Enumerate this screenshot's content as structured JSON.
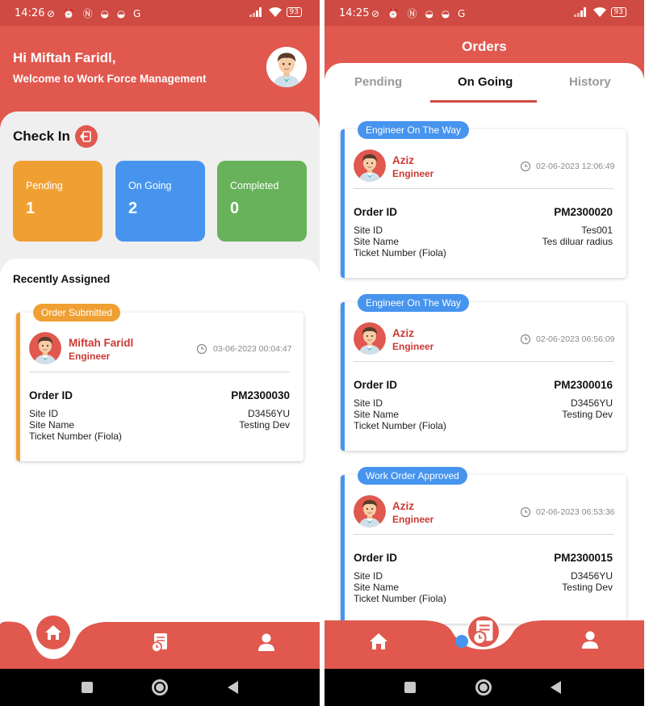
{
  "status_bar": {
    "left_time": "14:26",
    "right_time": "14:25",
    "notification_icons": [
      "no-call-icon",
      "alarm-icon",
      "nfc-icon",
      "game-icon",
      "game-icon",
      "google-icon"
    ],
    "battery": "93"
  },
  "home": {
    "greeting": "Hi Miftah Faridl,",
    "welcome": "Welcome to Work Force Management",
    "check_in_label": "Check In",
    "stats": [
      {
        "label": "Pending",
        "value": "1",
        "color": "#f0a033"
      },
      {
        "label": "On Going",
        "value": "2",
        "color": "#4794ee"
      },
      {
        "label": "Completed",
        "value": "0",
        "color": "#67b25a"
      }
    ],
    "recent_title": "Recently Assigned",
    "recent_card": {
      "badge": "Order Submitted",
      "badge_color": "#f0a033",
      "name": "Miftah Faridl",
      "role": "Engineer",
      "datetime": "03-06-2023 00:04:47",
      "order_id_label": "Order ID",
      "order_id": "PM2300030",
      "site_id_label": "Site ID",
      "site_id": "D3456YU",
      "site_name_label": "Site Name",
      "site_name": "Testing Dev",
      "ticket_label": "Ticket Number (Fiola)",
      "ticket": ""
    }
  },
  "orders": {
    "title": "Orders",
    "tabs": [
      "Pending",
      "On Going",
      "History"
    ],
    "active_tab": "On Going",
    "accent_color": "#4794ee",
    "cards": [
      {
        "badge": "Engineer On The Way",
        "name": "Aziz",
        "role": "Engineer",
        "datetime": "02-06-2023 12:06:49",
        "order_id_label": "Order ID",
        "order_id": "PM2300020",
        "site_id_label": "Site ID",
        "site_id": "Tes001",
        "site_name_label": "Site Name",
        "site_name": "Tes diluar radius",
        "ticket_label": "Ticket Number (Fiola)",
        "ticket": ""
      },
      {
        "badge": "Engineer On The Way",
        "name": "Aziz",
        "role": "Engineer",
        "datetime": "02-06-2023 06:56:09",
        "order_id_label": "Order ID",
        "order_id": "PM2300016",
        "site_id_label": "Site ID",
        "site_id": "D3456YU",
        "site_name_label": "Site Name",
        "site_name": "Testing Dev",
        "ticket_label": "Ticket Number (Fiola)",
        "ticket": ""
      },
      {
        "badge": "Work Order Approved",
        "name": "Aziz",
        "role": "Engineer",
        "datetime": "02-06-2023 06:53:36",
        "order_id_label": "Order ID",
        "order_id": "PM2300015",
        "site_id_label": "Site ID",
        "site_id": "D3456YU",
        "site_name_label": "Site Name",
        "site_name": "Testing Dev",
        "ticket_label": "Ticket Number (Fiola)",
        "ticket": ""
      }
    ]
  },
  "bottom_nav": {
    "left_active": "home",
    "right_active": "orders",
    "items": [
      "home-icon",
      "orders-icon",
      "profile-icon"
    ]
  },
  "theme": {
    "primary": "#e0584e",
    "dark_primary": "#cf4a42",
    "name_color": "#cc3a33"
  }
}
